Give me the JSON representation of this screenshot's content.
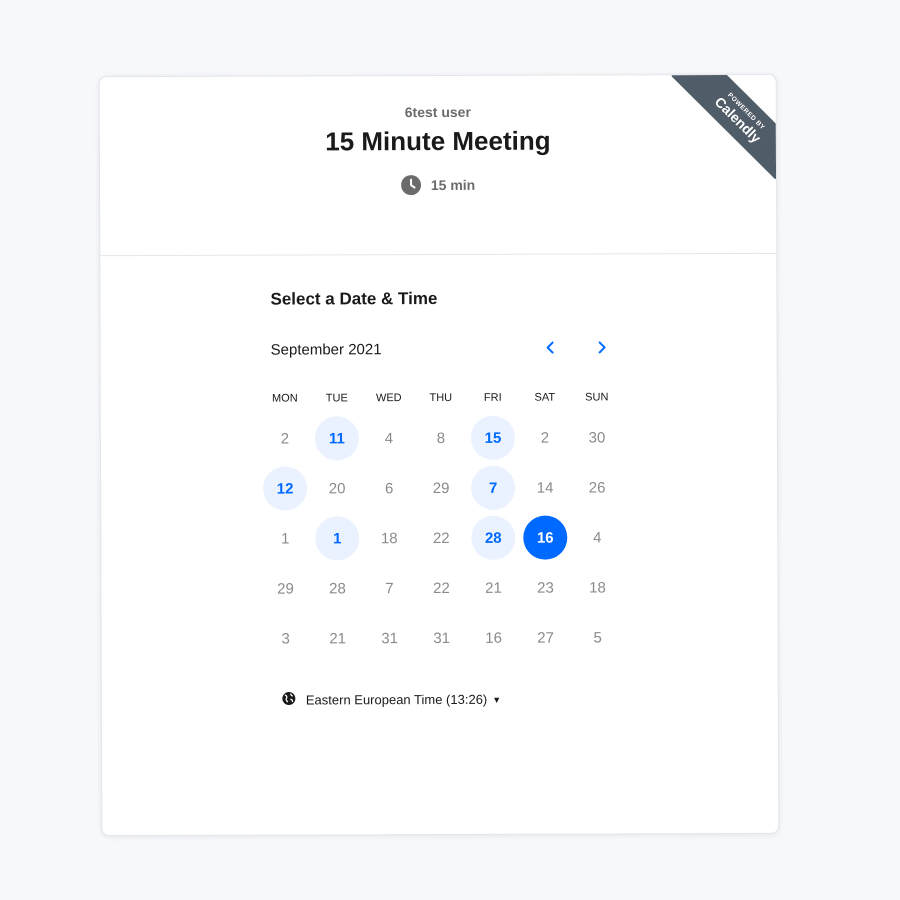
{
  "branding": {
    "ribbon_small": "POWERED BY",
    "ribbon_big": "Calendly"
  },
  "event": {
    "host": "6test user",
    "title": "15 Minute Meeting",
    "duration": "15 min",
    "duration_icon": "clock-icon"
  },
  "picker": {
    "section_title": "Select a Date & Time",
    "month_label": "September 2021",
    "prev_icon": "chevron-left-icon",
    "next_icon": "chevron-right-icon",
    "weekdays": [
      "MON",
      "TUE",
      "WED",
      "THU",
      "FRI",
      "SAT",
      "SUN"
    ],
    "weeks": [
      [
        {
          "d": "2",
          "s": "off"
        },
        {
          "d": "11",
          "s": "avail"
        },
        {
          "d": "4",
          "s": "off"
        },
        {
          "d": "8",
          "s": "off"
        },
        {
          "d": "15",
          "s": "avail"
        },
        {
          "d": "2",
          "s": "off"
        },
        {
          "d": "30",
          "s": "off"
        }
      ],
      [
        {
          "d": "12",
          "s": "avail"
        },
        {
          "d": "20",
          "s": "off"
        },
        {
          "d": "6",
          "s": "off"
        },
        {
          "d": "29",
          "s": "off"
        },
        {
          "d": "7",
          "s": "avail"
        },
        {
          "d": "14",
          "s": "off"
        },
        {
          "d": "26",
          "s": "off"
        }
      ],
      [
        {
          "d": "1",
          "s": "off"
        },
        {
          "d": "1",
          "s": "avail"
        },
        {
          "d": "18",
          "s": "off"
        },
        {
          "d": "22",
          "s": "off"
        },
        {
          "d": "28",
          "s": "avail"
        },
        {
          "d": "16",
          "s": "selected"
        },
        {
          "d": "4",
          "s": "off"
        }
      ],
      [
        {
          "d": "29",
          "s": "off"
        },
        {
          "d": "28",
          "s": "off"
        },
        {
          "d": "7",
          "s": "off"
        },
        {
          "d": "22",
          "s": "off"
        },
        {
          "d": "21",
          "s": "off"
        },
        {
          "d": "23",
          "s": "off"
        },
        {
          "d": "18",
          "s": "off"
        }
      ],
      [
        {
          "d": "3",
          "s": "off"
        },
        {
          "d": "21",
          "s": "off"
        },
        {
          "d": "31",
          "s": "off"
        },
        {
          "d": "31",
          "s": "off"
        },
        {
          "d": "16",
          "s": "off"
        },
        {
          "d": "27",
          "s": "off"
        },
        {
          "d": "5",
          "s": "off"
        }
      ]
    ],
    "timezone_label": "Eastern European Time (13:26)",
    "timezone_icon": "globe-icon"
  },
  "colors": {
    "accent": "#0069ff",
    "available_bg": "#e9f2fe",
    "ribbon": "#505d68"
  }
}
